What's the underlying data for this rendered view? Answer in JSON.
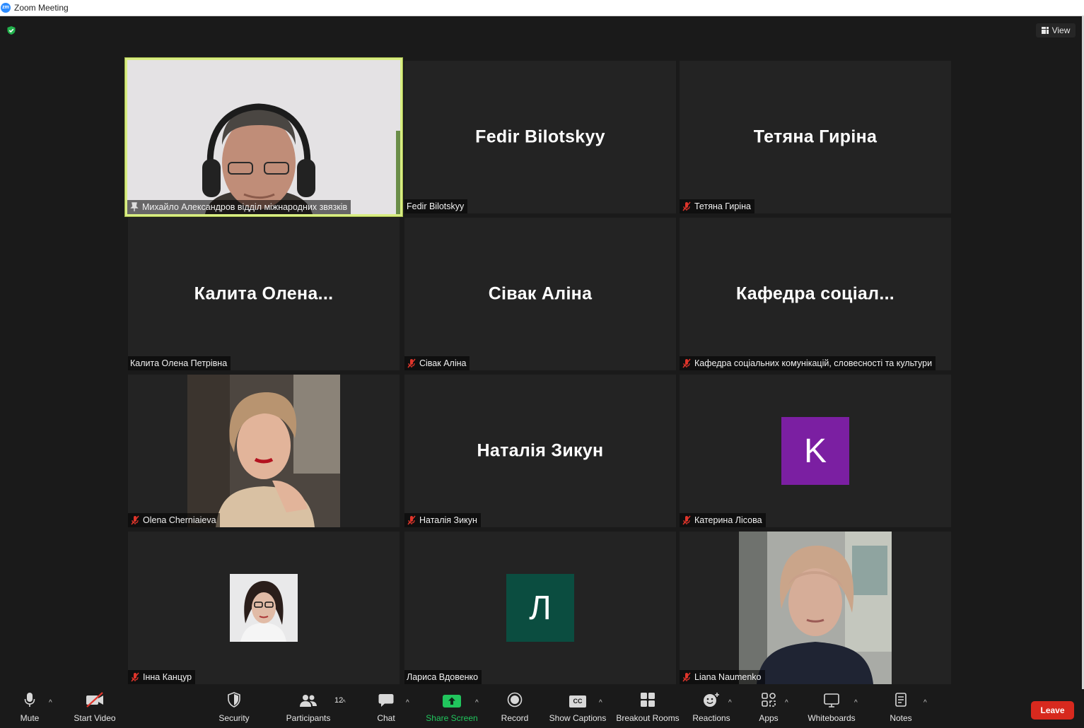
{
  "window": {
    "title": "Zoom Meeting",
    "logo_text": "zm"
  },
  "header": {
    "view_label": "View"
  },
  "tiles": [
    {
      "big_name": "",
      "label": "Михайло Александров відділ міжнародних звязків",
      "status": "pinned",
      "video": true
    },
    {
      "big_name": "Fedir Bilotskyy",
      "label": "Fedir Bilotskyy",
      "status": "none"
    },
    {
      "big_name": "Тетяна Гиріна",
      "label": "Тетяна Гиріна",
      "status": "muted"
    },
    {
      "big_name": "Калита  Олена...",
      "label": "Калита Олена Петрівна",
      "status": "none"
    },
    {
      "big_name": "Сівак Аліна",
      "label": "Сівак Аліна",
      "status": "muted"
    },
    {
      "big_name": "Кафедра  соціал...",
      "label": "Кафедра соціальних комунікацій, словесності та культури",
      "status": "muted"
    },
    {
      "big_name": "",
      "label": "Olena Cherniaieva",
      "status": "muted",
      "photo": true
    },
    {
      "big_name": "Наталія Зикун",
      "label": "Наталія Зикун",
      "status": "muted"
    },
    {
      "big_name": "",
      "label": "Катерина Лісова",
      "status": "muted",
      "avatar_letter": "K",
      "avatar_color": "#7b1fa2"
    },
    {
      "big_name": "",
      "label": "Інна Канцур",
      "status": "muted",
      "photo": true
    },
    {
      "big_name": "",
      "label": "Лариса Вдовенко",
      "status": "none",
      "avatar_letter": "Л",
      "avatar_color": "#0b4d40"
    },
    {
      "big_name": "",
      "label": "Liana Naumenko",
      "status": "muted",
      "photo": true
    }
  ],
  "toolbar": {
    "mute": "Mute",
    "start_video": "Start Video",
    "security": "Security",
    "participants": "Participants",
    "participants_count": "12",
    "chat": "Chat",
    "share_screen": "Share Screen",
    "record": "Record",
    "show_captions": "Show Captions",
    "captions_icon_text": "CC",
    "breakout_rooms": "Breakout Rooms",
    "reactions": "Reactions",
    "apps": "Apps",
    "whiteboards": "Whiteboards",
    "notes": "Notes",
    "leave": "Leave",
    "caret": "^"
  },
  "colors": {
    "active_speaker_border": "#d9ee83",
    "share_green": "#21c55d",
    "leave_red": "#d7291e",
    "muted_red": "#e0352b"
  }
}
